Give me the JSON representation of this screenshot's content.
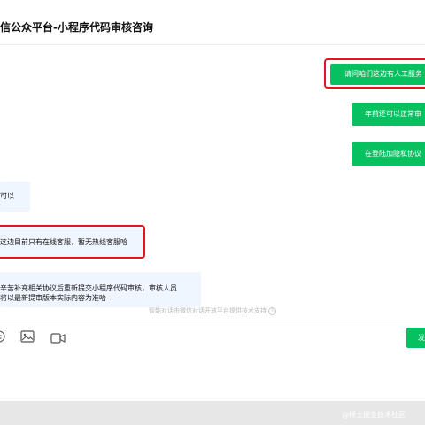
{
  "header": {
    "title": "信公众平台-小程序代码审核咨询"
  },
  "messages": [
    {
      "side": "right",
      "text": "请问咱们这边有人工服务"
    },
    {
      "side": "right",
      "text": "年前还可以正常审"
    },
    {
      "side": "right",
      "text": "在登陆加隐私协议"
    },
    {
      "side": "left",
      "text": "可以"
    },
    {
      "side": "left",
      "text": "这边目前只有在线客服，暂无热线客服哈"
    },
    {
      "side": "left",
      "text_line1": "辛苦补充相关协议后重新提交小程序代码审核，审核人员",
      "text_line2": "将以最新提审版本实际内容为准哈~"
    }
  ],
  "footer_note": "智能对话由微信对话开放平台提供技术支持",
  "toolbar": {
    "emoji_icon": "emoji-icon",
    "image_icon": "image-icon",
    "video_icon": "video-icon",
    "send_label": "发"
  },
  "watermark": "@稀土掘金技术社区",
  "colors": {
    "accent": "#07c160",
    "highlight": "#e2171d",
    "left_bubble": "#f0f6ff"
  }
}
